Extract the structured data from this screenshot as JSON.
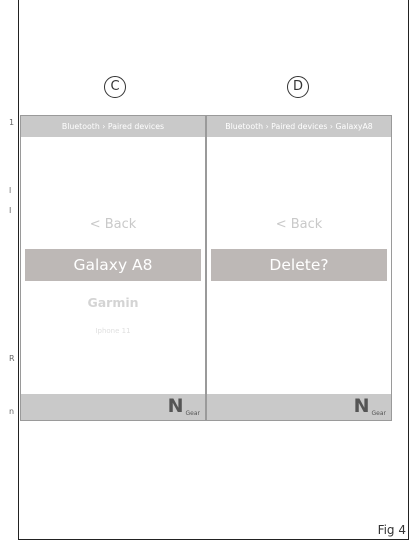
{
  "margin_marks": [
    "1",
    "l",
    "I",
    "R",
    "n"
  ],
  "panel_c": {
    "label": "C",
    "breadcrumb": "Bluetooth › Paired devices",
    "back": "< Back",
    "selected_device": "Galaxy A8",
    "device_2": "Garmin",
    "device_3": "Iphone 11",
    "logo_letter": "N",
    "logo_text": "Gear"
  },
  "panel_d": {
    "label": "D",
    "breadcrumb": "Bluetooth › Paired devices › GalaxyA8",
    "back": "< Back",
    "prompt": "Delete?",
    "logo_letter": "N",
    "logo_text": "Gear"
  },
  "figure_label": "Fig 4"
}
